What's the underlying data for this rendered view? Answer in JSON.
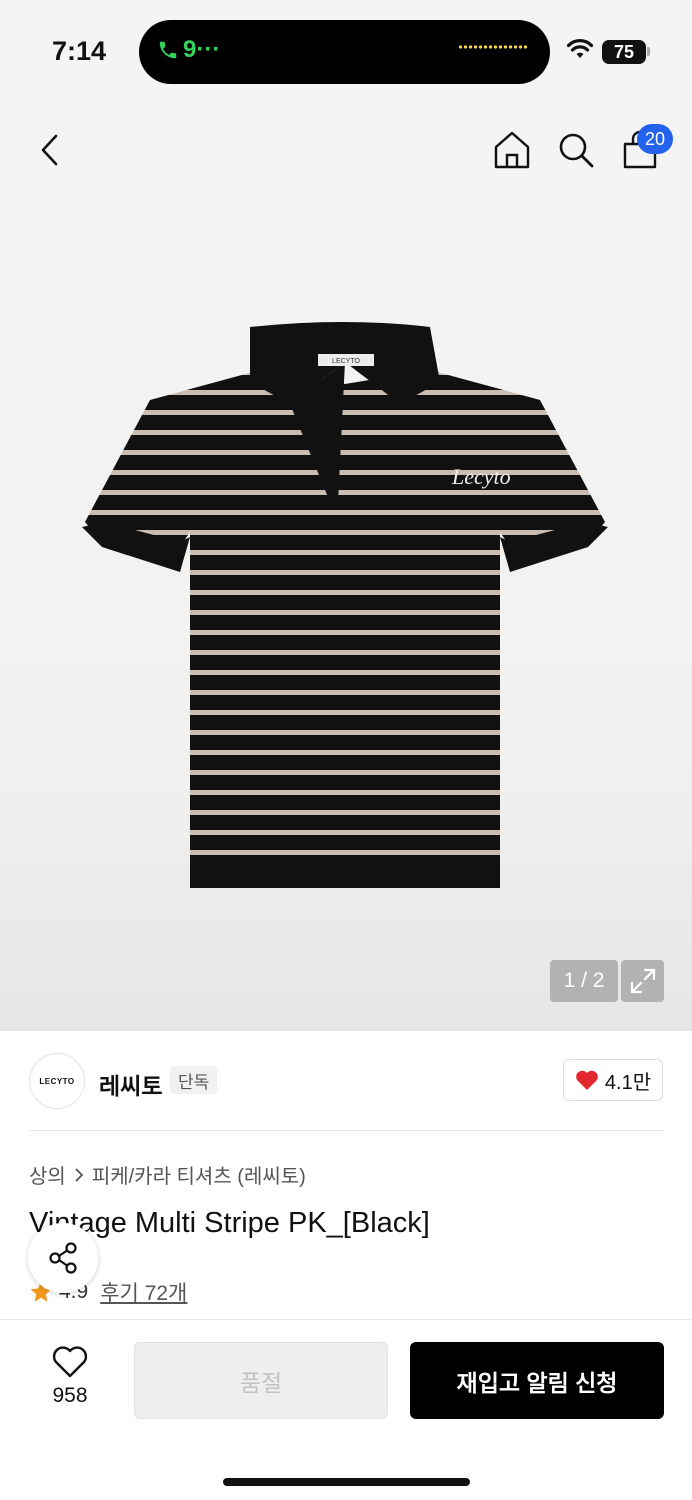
{
  "status_bar": {
    "time": "7:14",
    "call_text": "9···",
    "battery": "75"
  },
  "header": {
    "cart_count": "20"
  },
  "gallery": {
    "counter": "1 / 2",
    "shirt_collar_label": "LECYTO",
    "shirt_logo_text": "Lecyto",
    "colors": {
      "shirt": "#111111",
      "stripe": "#c9bdb2"
    }
  },
  "brand": {
    "logo_text": "LECYTO",
    "name": "레씨토",
    "tag": "단독",
    "likes": "4.1만"
  },
  "product": {
    "breadcrumb_category": "상의",
    "breadcrumb_subcategory": "피케/카라 티셔츠 (레씨토)",
    "title": "Vintage Multi Stripe PK_[Black]",
    "rating": "4.9",
    "reviews": "후기 72개"
  },
  "bottom_bar": {
    "wish_count": "958",
    "soldout_label": "품절",
    "restock_label": "재입고 알림 신청"
  },
  "icons": [
    "back-icon",
    "home-icon",
    "search-icon",
    "cart-icon",
    "expand-icon",
    "heart-icon",
    "share-icon",
    "star-icon",
    "chevron-right-icon"
  ]
}
